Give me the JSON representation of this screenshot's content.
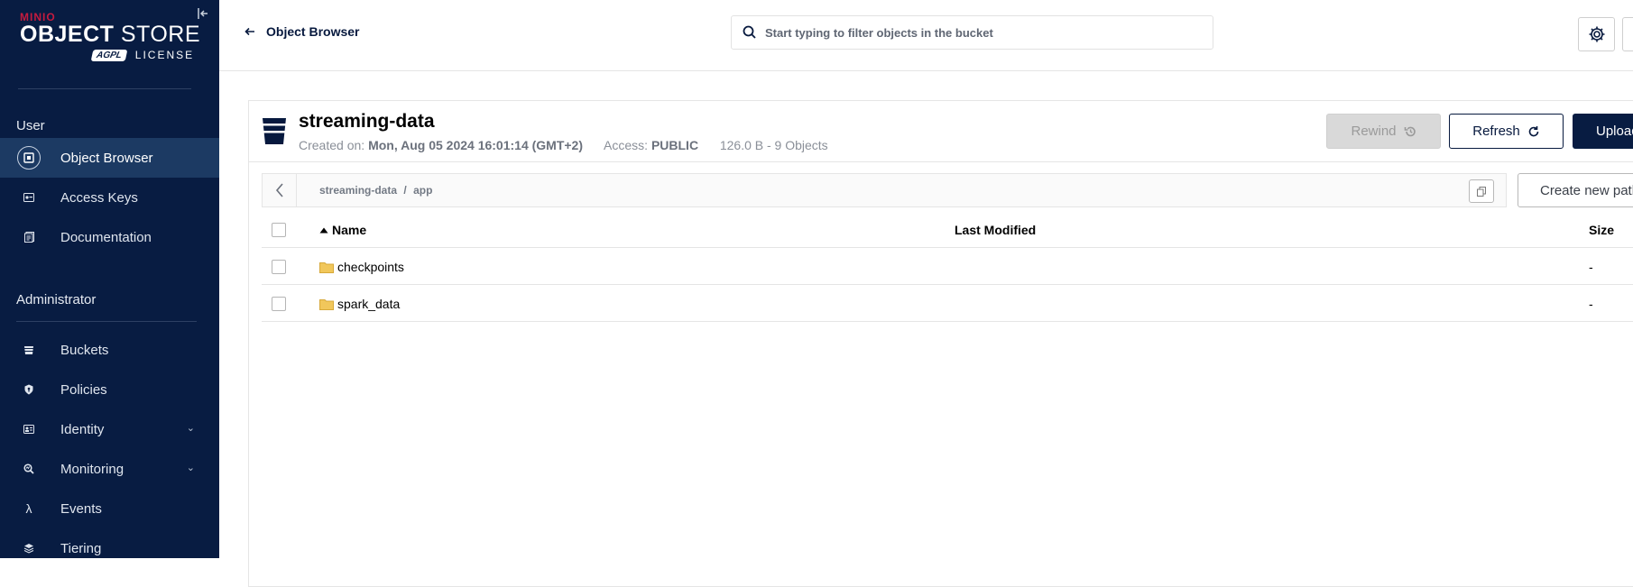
{
  "sidebar": {
    "brand": {
      "minio": "MINIO",
      "title_bold": "OBJECT",
      "title_light": " STORE",
      "badge": "AGPL",
      "license": "LICENSE"
    },
    "user_section": "User",
    "user_items": [
      {
        "label": "Object Browser",
        "icon": "object-browser-icon",
        "active": true
      },
      {
        "label": "Access Keys",
        "icon": "key-icon"
      },
      {
        "label": "Documentation",
        "icon": "docs-icon"
      }
    ],
    "admin_section": "Administrator",
    "admin_items": [
      {
        "label": "Buckets",
        "icon": "bucket-icon"
      },
      {
        "label": "Policies",
        "icon": "shield-icon"
      },
      {
        "label": "Identity",
        "icon": "identity-icon",
        "expandable": true
      },
      {
        "label": "Monitoring",
        "icon": "monitoring-icon",
        "expandable": true
      },
      {
        "label": "Events",
        "icon": "lambda-icon"
      },
      {
        "label": "Tiering",
        "icon": "tiers-icon"
      }
    ]
  },
  "topbar": {
    "back_label": "Object Browser",
    "search_placeholder": "Start typing to filter objects in the bucket"
  },
  "bucket": {
    "name": "streaming-data",
    "created_label": "Created on:",
    "created_value": "Mon, Aug 05 2024 16:01:14 (GMT+2)",
    "access_label": "Access:",
    "access_value": "PUBLIC",
    "usage": "126.0 B - 9 Objects"
  },
  "actions": {
    "rewind": "Rewind",
    "refresh": "Refresh",
    "upload": "Upload",
    "create_path": "Create new path"
  },
  "breadcrumb": {
    "bucket": "streaming-data",
    "separator": "/",
    "folder": "app"
  },
  "table": {
    "headers": {
      "name": "Name",
      "last_modified": "Last Modified",
      "size": "Size"
    },
    "rows": [
      {
        "name": "checkpoints",
        "last_modified": "",
        "size": "-"
      },
      {
        "name": "spark_data",
        "last_modified": "",
        "size": "-"
      }
    ]
  },
  "colors": {
    "sidebar_bg": "#081c42",
    "active_item": "#1c3a63",
    "primary": "#081c42",
    "brand_red": "#c51b3f",
    "folder": "#f1c75b"
  }
}
